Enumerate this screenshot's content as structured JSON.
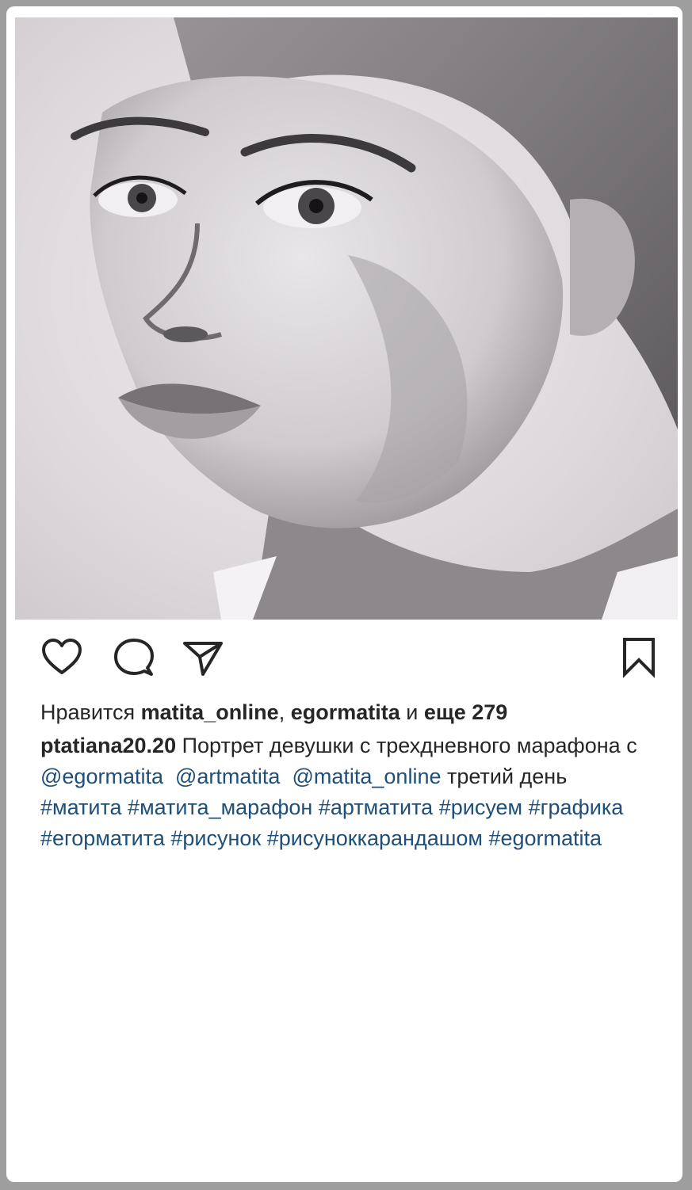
{
  "post": {
    "image": {
      "name": "pencil-portrait-drawing"
    },
    "actions": {
      "like_icon": "heart-icon",
      "comment_icon": "comment-icon",
      "share_icon": "send-icon",
      "save_icon": "bookmark-icon"
    },
    "likes": {
      "prefix": "Нравится",
      "user1": "matita_online",
      "sep": ",",
      "user2": "egormatita",
      "and": "и",
      "more": "еще 279"
    },
    "caption": {
      "username": "ptatiana20.20",
      "text1": "Портрет девушки с трехдневного марафона с",
      "mention1": "@egormatita",
      "mention2": "@artmatita",
      "mention3": "@matita_online",
      "text2": "третий день",
      "tags": [
        "#матита",
        "#матита_марафон",
        "#артматита",
        "#рисуем",
        "#графика",
        "#егорматита",
        "#рисунок",
        "#рисуноккарандашом",
        "#egormatita"
      ]
    }
  },
  "colors": {
    "text": "#262626",
    "link": "#1d4f7a",
    "frame": "#9e9e9e"
  }
}
